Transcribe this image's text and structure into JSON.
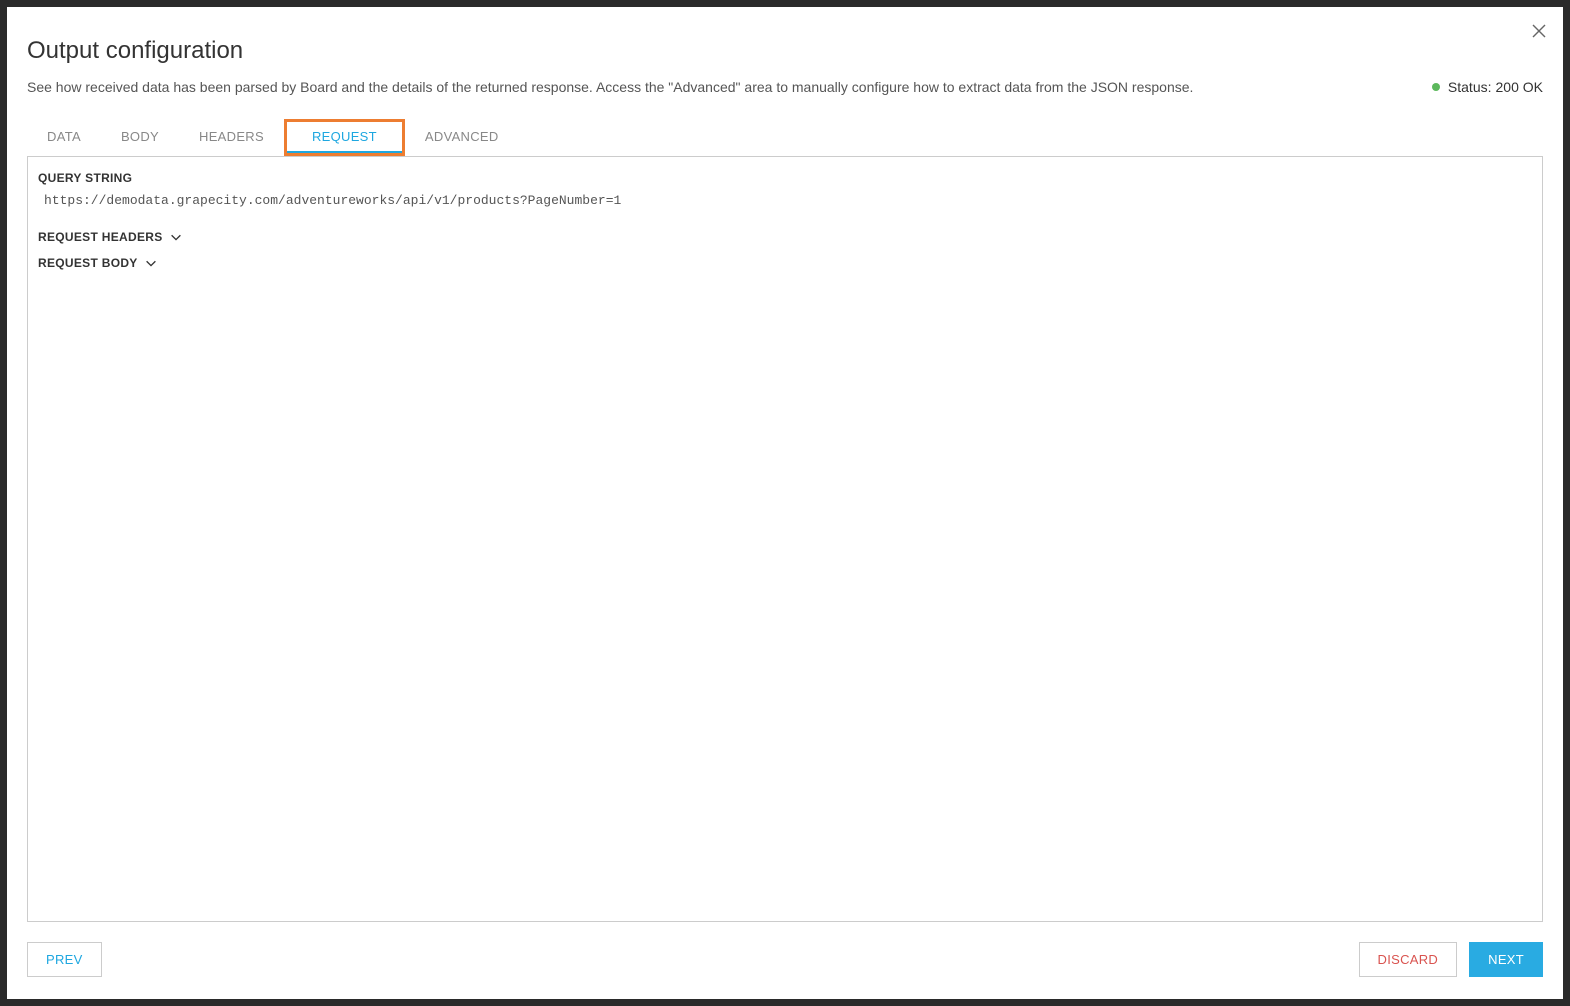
{
  "header": {
    "title": "Output configuration",
    "subtitle": "See how received data has been parsed by Board and the details of the returned response. Access the \"Advanced\" area to manually configure how to extract data from the JSON response.",
    "status_label": "Status:",
    "status_value": "200 OK"
  },
  "tabs": [
    {
      "label": "DATA",
      "active": false
    },
    {
      "label": "BODY",
      "active": false
    },
    {
      "label": "HEADERS",
      "active": false
    },
    {
      "label": "REQUEST",
      "active": true
    },
    {
      "label": "ADVANCED",
      "active": false
    }
  ],
  "panel": {
    "query_string_label": "QUERY STRING",
    "query_string_value": "https://demodata.grapecity.com/adventureworks/api/v1/products?PageNumber=1",
    "request_headers_label": "REQUEST HEADERS",
    "request_body_label": "REQUEST BODY"
  },
  "footer": {
    "prev_label": "PREV",
    "discard_label": "DISCARD",
    "next_label": "NEXT"
  }
}
